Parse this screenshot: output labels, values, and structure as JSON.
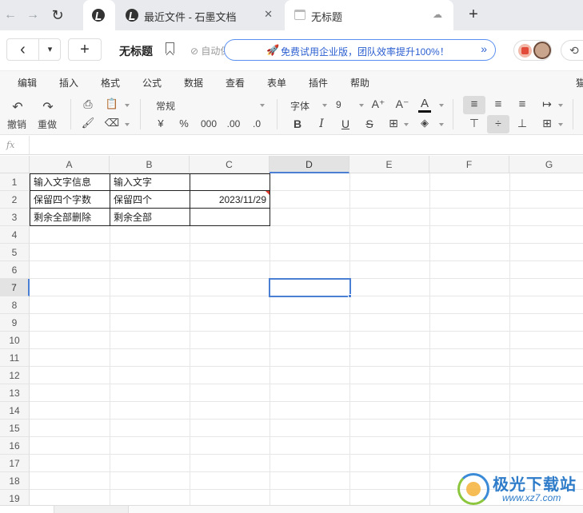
{
  "browser": {
    "tabs": [
      {
        "title": "最近文件 - 石墨文档",
        "close": "✕",
        "icon": "shimo-logo-icon"
      },
      {
        "title": "无标题",
        "icon": "sheet-icon",
        "status_icon": "cloud-icon"
      }
    ],
    "nav": {
      "back": "←",
      "forward": "→",
      "reload": "↻",
      "new_tab": "+"
    }
  },
  "header": {
    "back_label": "‹",
    "dropdown_label": "▾",
    "new_label": "+",
    "doc_title": "无标题",
    "autosave": "⊘ 自动保存成功",
    "promo_icon": "🚀",
    "promo_text": "免费试用企业版，团队效率提升100%！",
    "promo_chevron": "»",
    "history_icon": "⟲"
  },
  "menu": [
    "编辑",
    "插入",
    "格式",
    "公式",
    "数据",
    "查看",
    "表单",
    "插件",
    "帮助",
    "猫"
  ],
  "toolbar": {
    "undo": "撤销",
    "redo": "重做",
    "number_format": "常规",
    "currency": "¥",
    "percent": "%",
    "thousands": "000",
    "dec_increase": ".00",
    "dec_decrease": ".0",
    "font": "字体",
    "font_size": "9",
    "font_grow": "A⁺",
    "font_shrink": "A⁻",
    "font_color": "A",
    "bold": "B",
    "italic": "I",
    "underline": "U",
    "strike": "S",
    "borders": "⊞",
    "fill": "◈",
    "align_left": "≡",
    "align_center": "≡",
    "align_right": "≡",
    "wrap": "↦",
    "valign_top": "⊤",
    "valign_middle": "÷",
    "valign_bottom": "⊥",
    "merge": "⊞"
  },
  "formula_bar": {
    "fx": "fx",
    "value": ""
  },
  "sheet": {
    "columns": [
      "A",
      "B",
      "C",
      "D",
      "E",
      "F",
      "G"
    ],
    "rows": [
      "1",
      "2",
      "3",
      "4",
      "5",
      "6",
      "7",
      "8",
      "9",
      "10",
      "11",
      "12",
      "13",
      "14",
      "15",
      "16",
      "17",
      "18",
      "19"
    ],
    "selected_cell": "D7",
    "cells": {
      "A1": "输入文字信息",
      "B1": "输入文字",
      "A2": "保留四个字数",
      "B2": "保留四个",
      "C2": "2023/11/29",
      "A3": "剩余全部删除",
      "B3": "剩余全部"
    }
  },
  "watermark": {
    "text": "极光下载站",
    "url": "www.xz7.com"
  }
}
